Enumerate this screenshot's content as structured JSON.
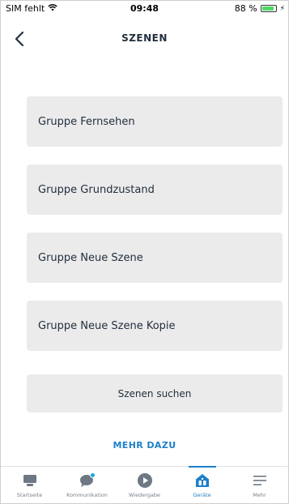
{
  "status_bar": {
    "carrier": "SIM fehlt",
    "time": "09:48",
    "battery": "88 %",
    "battery_level": 0.88
  },
  "header": {
    "title": "SZENEN"
  },
  "scenes": [
    {
      "label": "Gruppe Fernsehen"
    },
    {
      "label": "Gruppe Grundzustand"
    },
    {
      "label": "Gruppe Neue Szene"
    },
    {
      "label": "Gruppe Neue Szene Kopie"
    }
  ],
  "search_button": {
    "label": "Szenen suchen"
  },
  "more_link": {
    "label": "MEHR DAZU"
  },
  "tabs": [
    {
      "label": "Startseite",
      "icon": "home-icon"
    },
    {
      "label": "Kommunikation",
      "icon": "chat-bubble-icon"
    },
    {
      "label": "Wiedergabe",
      "icon": "play-icon"
    },
    {
      "label": "Geräte",
      "icon": "devices-house-icon",
      "active": true
    },
    {
      "label": "Mehr",
      "icon": "menu-icon"
    }
  ],
  "colors": {
    "accent": "#1d7fc8",
    "card_bg": "#ebebeb",
    "text": "#232f3e",
    "tab_icon": "#6d7882",
    "notification_dot": "#1fa7e0"
  }
}
